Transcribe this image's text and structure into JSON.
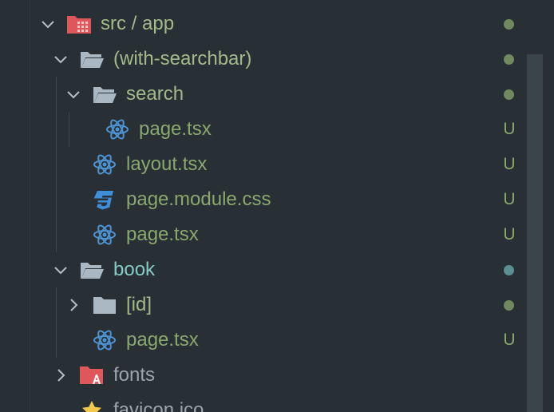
{
  "tree": {
    "root": {
      "name": "src / app",
      "expanded": true,
      "icon": "app-folder-icon"
    },
    "items": [
      {
        "label": "(with-searchbar)",
        "kind": "folder",
        "expanded": true,
        "status": "dot"
      },
      {
        "label": "search",
        "kind": "folder",
        "expanded": true,
        "status": "dot"
      },
      {
        "label": "page.tsx",
        "kind": "react-file",
        "status": "U"
      },
      {
        "label": "layout.tsx",
        "kind": "react-file",
        "status": "U"
      },
      {
        "label": "page.module.css",
        "kind": "css-file",
        "status": "U"
      },
      {
        "label": "page.tsx",
        "kind": "react-file",
        "status": "U"
      },
      {
        "label": "book",
        "kind": "folder",
        "expanded": true,
        "status": "dot"
      },
      {
        "label": "[id]",
        "kind": "folder",
        "expanded": false,
        "status": "dot"
      },
      {
        "label": "page.tsx",
        "kind": "react-file",
        "status": "U"
      },
      {
        "label": "fonts",
        "kind": "fonts-folder",
        "expanded": false
      },
      {
        "label": "favicon.ico",
        "kind": "favicon"
      }
    ]
  },
  "colors": {
    "background": "#283036",
    "untracked_text": "#8aa86e",
    "folder_text": "#a4b98a",
    "open_folder_teal": "#84cbc6",
    "react_icon": "#4e93d1",
    "css_icon": "#3f8fd8",
    "folder_icon": "#a9b8c2",
    "app_folder_icon": "#e0575b",
    "status_dot": "#6f8a61"
  }
}
